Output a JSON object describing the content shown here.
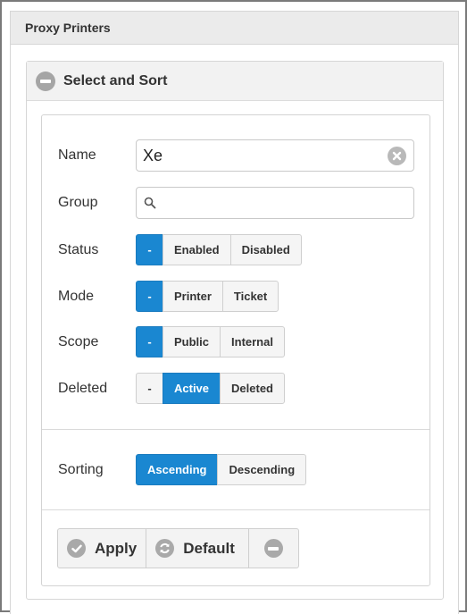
{
  "panel": {
    "title": "Proxy Printers"
  },
  "section": {
    "title": "Select and Sort"
  },
  "filters": {
    "name": {
      "label": "Name",
      "value": "Xe"
    },
    "group": {
      "label": "Group",
      "value": ""
    },
    "status": {
      "label": "Status",
      "options": [
        "-",
        "Enabled",
        "Disabled"
      ],
      "selected": "-"
    },
    "mode": {
      "label": "Mode",
      "options": [
        "-",
        "Printer",
        "Ticket"
      ],
      "selected": "-"
    },
    "scope": {
      "label": "Scope",
      "options": [
        "-",
        "Public",
        "Internal"
      ],
      "selected": "-"
    },
    "deleted": {
      "label": "Deleted",
      "options": [
        "-",
        "Active",
        "Deleted"
      ],
      "selected": "Active"
    }
  },
  "sorting": {
    "label": "Sorting",
    "options": [
      "Ascending",
      "Descending"
    ],
    "selected": "Ascending"
  },
  "actions": {
    "apply": "Apply",
    "default": "Default"
  },
  "colors": {
    "accent": "#1a87d1",
    "icon_gray": "#a9a9a9"
  }
}
